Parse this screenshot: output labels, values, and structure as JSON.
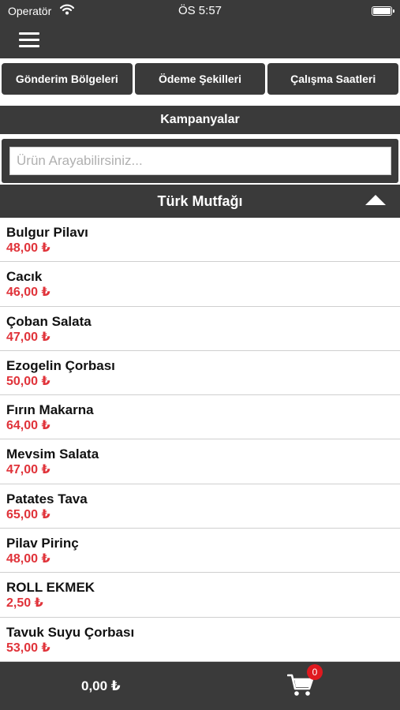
{
  "status_bar": {
    "carrier": "Operatör",
    "time": "ÖS 5:57"
  },
  "header": {
    "menu_icon": "hamburger-menu-icon"
  },
  "tabs": [
    {
      "label": "Gönderim Bölgeleri"
    },
    {
      "label": "Ödeme Şekilleri"
    },
    {
      "label": "Çalışma Saatleri"
    }
  ],
  "campaign": {
    "label": "Kampanyalar"
  },
  "search": {
    "placeholder": "Ürün Arayabilirsiniz...",
    "value": ""
  },
  "category": {
    "title": "Türk Mutfağı",
    "toggle_icon": "collapse-up-arrow-icon"
  },
  "products": [
    {
      "name": "Bulgur Pilavı",
      "price": "48,00 ₺"
    },
    {
      "name": "Cacık",
      "price": "46,00 ₺"
    },
    {
      "name": "Çoban Salata",
      "price": "47,00 ₺"
    },
    {
      "name": "Ezogelin Çorbası",
      "price": "50,00 ₺"
    },
    {
      "name": "Fırın Makarna",
      "price": "64,00 ₺"
    },
    {
      "name": "Mevsim Salata",
      "price": "47,00 ₺"
    },
    {
      "name": "Patates Tava",
      "price": "65,00 ₺"
    },
    {
      "name": "Pilav Pirinç",
      "price": "48,00 ₺"
    },
    {
      "name": "ROLL EKMEK",
      "price": "2,50 ₺"
    },
    {
      "name": "Tavuk Suyu Çorbası",
      "price": "53,00 ₺"
    }
  ],
  "footer": {
    "total": "0,00 ₺",
    "cart_count": "0",
    "cart_icon": "shopping-cart-icon"
  },
  "colors": {
    "bar": "#3a3a3a",
    "price": "#e0333a",
    "badge": "#e0191f"
  }
}
